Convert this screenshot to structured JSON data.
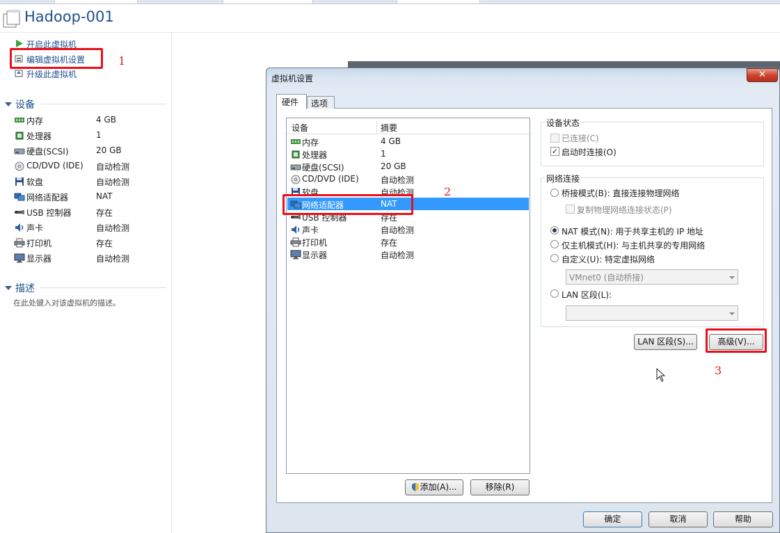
{
  "vm": {
    "name": "Hadoop-001",
    "actions": [
      "开启此虚拟机",
      "编辑虚拟机设置",
      "升级此虚拟机"
    ]
  },
  "sidebar": {
    "devices_heading": "设备",
    "devices": [
      {
        "name": "内存",
        "value": "4 GB",
        "icon": "memory-icon"
      },
      {
        "name": "处理器",
        "value": "1",
        "icon": "processor-icon"
      },
      {
        "name": "硬盘(SCSI)",
        "value": "20 GB",
        "icon": "hard-disk-icon"
      },
      {
        "name": "CD/DVD (IDE)",
        "value": "自动检测",
        "icon": "cd-dvd-icon"
      },
      {
        "name": "软盘",
        "value": "自动检测",
        "icon": "floppy-icon"
      },
      {
        "name": "网络适配器",
        "value": "NAT",
        "icon": "network-adapter-icon"
      },
      {
        "name": "USB 控制器",
        "value": "存在",
        "icon": "usb-icon"
      },
      {
        "name": "声卡",
        "value": "自动检测",
        "icon": "sound-card-icon"
      },
      {
        "name": "打印机",
        "value": "存在",
        "icon": "printer-icon"
      },
      {
        "name": "显示器",
        "value": "自动检测",
        "icon": "display-icon"
      }
    ],
    "description_heading": "描述",
    "description_placeholder": "在此处键入对该虚拟机的描述。"
  },
  "annotations": {
    "step1": "1",
    "step2": "2",
    "step3": "3",
    "highlight_color": "#e8101a"
  },
  "dialog": {
    "title": "虚拟机设置",
    "close_label": "✕",
    "tabs": [
      "硬件",
      "选项"
    ],
    "list_headers": [
      "设备",
      "摘要"
    ],
    "devices": [
      {
        "name": "内存",
        "summary": "4 GB",
        "icon": "memory-icon"
      },
      {
        "name": "处理器",
        "summary": "1",
        "icon": "processor-icon"
      },
      {
        "name": "硬盘(SCSI)",
        "summary": "20 GB",
        "icon": "hard-disk-icon"
      },
      {
        "name": "CD/DVD (IDE)",
        "summary": "自动检测",
        "icon": "cd-dvd-icon"
      },
      {
        "name": "软盘",
        "summary": "自动检测",
        "icon": "floppy-icon"
      },
      {
        "name": "网络适配器",
        "summary": "NAT",
        "icon": "network-adapter-icon",
        "selected": true
      },
      {
        "name": "USB 控制器",
        "summary": "存在",
        "icon": "usb-icon"
      },
      {
        "name": "声卡",
        "summary": "自动检测",
        "icon": "sound-card-icon"
      },
      {
        "name": "打印机",
        "summary": "存在",
        "icon": "printer-icon"
      },
      {
        "name": "显示器",
        "summary": "自动检测",
        "icon": "display-icon"
      }
    ],
    "add_button": "添加(A)...",
    "remove_button": "移除(R)",
    "device_status": {
      "label": "设备状态",
      "connected": {
        "label": "已连接(C)",
        "checked": false,
        "disabled": true
      },
      "connect_at_power_on": {
        "label": "启动时连接(O)",
        "checked": true
      }
    },
    "network": {
      "label": "网络连接",
      "bridged": "桥接模式(B): 直接连接物理网络",
      "replicate": "复制物理网络连接状态(P)",
      "nat": "NAT 模式(N): 用于共享主机的 IP 地址",
      "host_only": "仅主机模式(H): 与主机共享的专用网络",
      "custom": "自定义(U): 特定虚拟网络",
      "custom_network_value": "VMnet0 (自动桥接)",
      "lan_segment": "LAN 区段(L):",
      "lan_segment_value": "",
      "selected": "nat"
    },
    "lan_segments_button": "LAN 区段(S)...",
    "advanced_button": "高级(V)...",
    "ok_button": "确定",
    "cancel_button": "取消",
    "help_button": "帮助",
    "selection_color": "#3399ff"
  }
}
